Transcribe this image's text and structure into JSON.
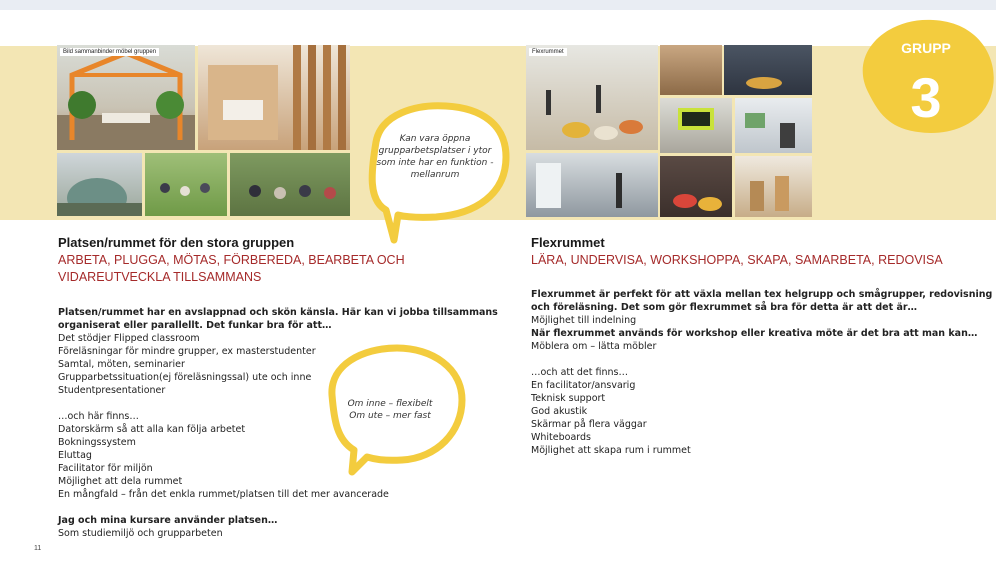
{
  "badge": {
    "label": "GRUPP",
    "number": "3"
  },
  "page_number": "11",
  "photos": {
    "left_tag": "Bild sammanbinder möbel gruppen",
    "right_tag": "Flexrummet"
  },
  "bubbles": {
    "top": "Kan vara öppna grupparbetsplatser i ytor som inte har en funktion - mellanrum",
    "middle_line1": "Om inne – flexibelt",
    "middle_line2": "Om ute – mer fast"
  },
  "left": {
    "title": "Platsen/rummet för den stora gruppen",
    "verbs_line1": "ARBETA, PLUGGA, MÖTAS, FÖRBEREDA, BEARBETA OCH",
    "verbs_line2": "VIDAREUTVECKLA TILLSAMMANS",
    "intro_bold_1": "Platsen/rummet har en avslappnad och skön känsla. Här kan vi jobba tillsammans",
    "intro_bold_2": "organiserat eller parallellt. Det funkar bra för att…",
    "items": [
      "Det stödjer Flipped classroom",
      "Föreläsningar för mindre grupper, ex masterstudenter",
      "Samtal, möten, seminarier",
      "Grupparbetssituation(ej föreläsningssal) ute och inne",
      "Studentpresentationer"
    ],
    "finns_heading": "…och här finns…",
    "finns_items": [
      "Datorskärm så att alla kan följa arbetet",
      "Bokningssystem",
      "Eluttag",
      "Facilitator för miljön",
      "Möjlighet att dela rummet",
      "En mångfald – från det enkla rummet/platsen till det mer avancerade"
    ],
    "jag_heading": "Jag och mina kursare använder platsen…",
    "jag_item": "Som studiemiljö och grupparbeten"
  },
  "right": {
    "title": "Flexrummet",
    "verbs": "LÄRA, UNDERVISA, WORKSHOPPA, SKAPA, SAMARBETA, REDOVISA",
    "intro_bold_1": "Flexrummet är perfekt för att växla mellan tex helgrupp och smågrupper, redovisning",
    "intro_bold_2": "och föreläsning. Det som gör flexrummet så bra för detta är att det är…",
    "intro_plain": "Möjlighet till indelning",
    "intro_bold_3": "När flexrummet används för workshop eller kreativa möte är det bra att man kan…",
    "intro_plain_2": "Möblera om – lätta möbler",
    "finns_heading": "…och att det finns…",
    "finns_items": [
      "En facilitator/ansvarig",
      "Teknisk support",
      "God akustik",
      "Skärmar på flera väggar",
      "Whiteboards",
      "Möjlighet att skapa rum i rummet"
    ]
  }
}
